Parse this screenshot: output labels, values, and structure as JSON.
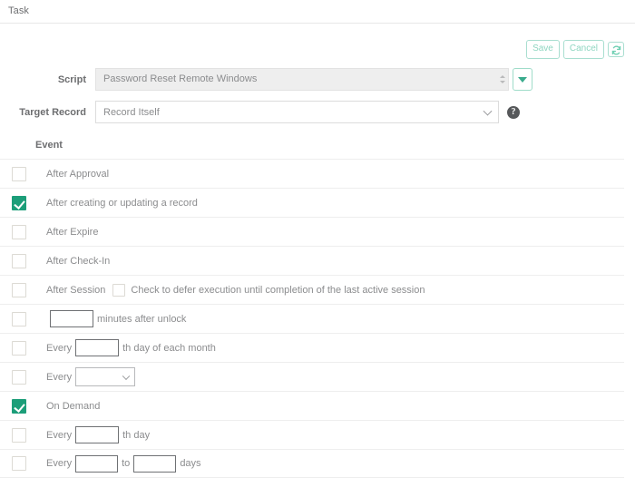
{
  "header": {
    "title": "Task"
  },
  "toolbar": {
    "save_label": "Save",
    "cancel_label": "Cancel",
    "refresh_icon": "refresh-icon"
  },
  "form": {
    "script": {
      "label": "Script",
      "value": "Password Reset Remote Windows",
      "dropdown_icon": "caret-down-icon",
      "spinner_icon": "spinner-arrows-icon"
    },
    "target_record": {
      "label": "Target Record",
      "value": "Record Itself",
      "chevron_icon": "chevron-down-icon",
      "help_icon": "help-icon",
      "help_glyph": "?"
    }
  },
  "event_table": {
    "column_header": "Event",
    "rows": [
      {
        "id": "after-approval",
        "checked": false,
        "label": "After Approval",
        "type": "simple"
      },
      {
        "id": "after-creating-or-updating-a-record",
        "checked": true,
        "label": "After creating or updating a record",
        "type": "simple"
      },
      {
        "id": "after-expire",
        "checked": false,
        "label": "After Expire",
        "type": "simple"
      },
      {
        "id": "after-check-in",
        "checked": false,
        "label": "After Check-In",
        "type": "simple"
      },
      {
        "id": "after-session",
        "checked": false,
        "label": "After Session",
        "type": "session",
        "inline_checked": false,
        "inline_label": "Check to defer execution until completion of the last active session"
      },
      {
        "id": "minutes-after-unlock",
        "checked": false,
        "type": "input-suffix",
        "input_value": "",
        "suffix": "minutes after unlock"
      },
      {
        "id": "every-nth-day-of-each-month",
        "checked": false,
        "type": "prefix-input-suffix",
        "prefix": "Every",
        "input_value": "",
        "suffix": "th day of each month"
      },
      {
        "id": "every-select",
        "checked": false,
        "type": "prefix-select",
        "prefix": "Every",
        "select_value": ""
      },
      {
        "id": "on-demand",
        "checked": true,
        "label": "On Demand",
        "type": "simple"
      },
      {
        "id": "every-nth-day",
        "checked": false,
        "type": "prefix-input-suffix",
        "prefix": "Every",
        "input_value": "",
        "suffix": "th day"
      },
      {
        "id": "every-to-days",
        "checked": false,
        "type": "range",
        "prefix": "Every",
        "from_value": "",
        "middle": "to",
        "to_value": "",
        "suffix": "days"
      }
    ]
  },
  "colors": {
    "accent_teal": "#1c9e79",
    "button_outline": "#a9ded0",
    "button_text": "#8fd6c1",
    "text": "#8b8c8e",
    "label": "#6d6e70",
    "divider": "#eeeeee"
  }
}
